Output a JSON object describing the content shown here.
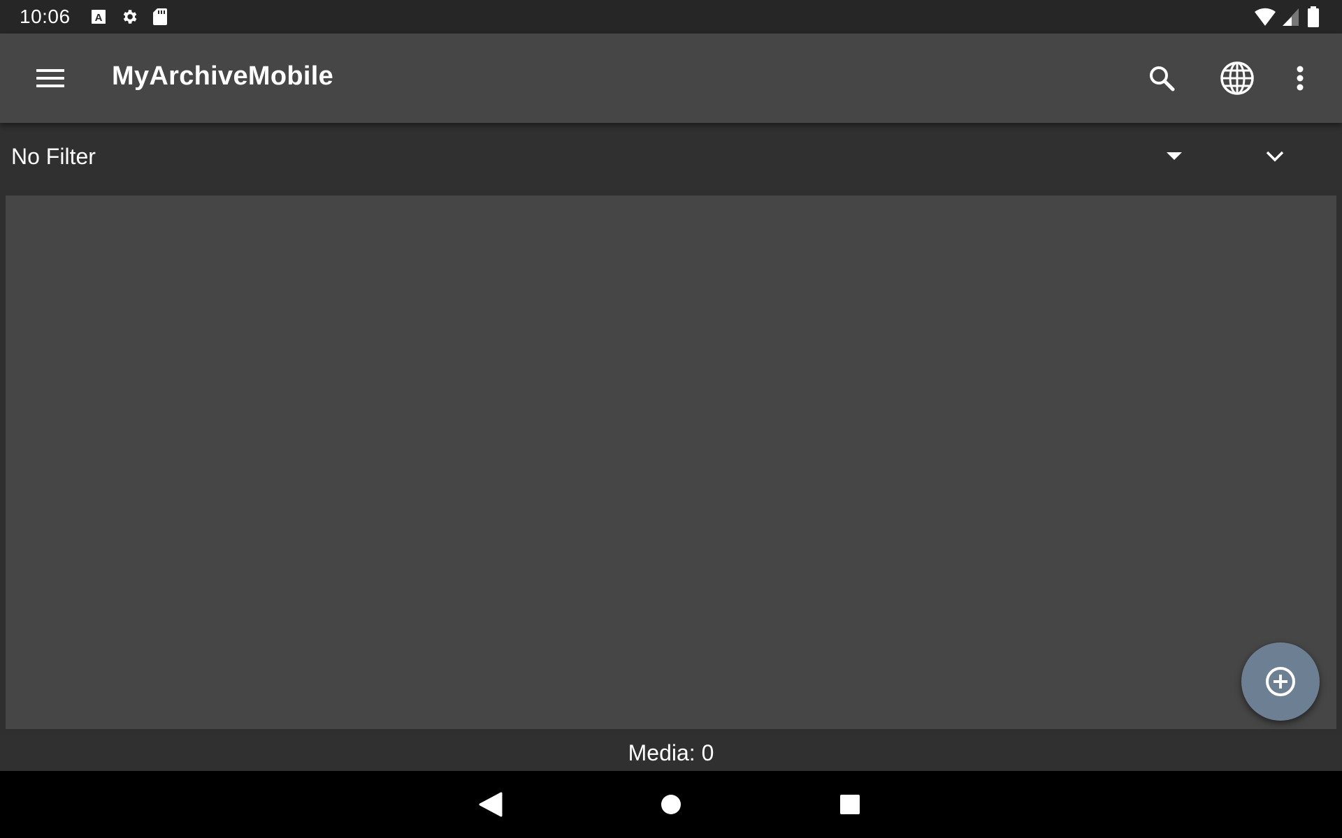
{
  "status_bar": {
    "time": "10:06",
    "icons": [
      "text-a-icon",
      "gear-icon",
      "sd-card-icon",
      "wifi-icon",
      "cell-signal-icon",
      "battery-icon"
    ]
  },
  "app_bar": {
    "title": "MyArchiveMobile",
    "actions": [
      "search-icon",
      "globe-icon",
      "more-vert-icon"
    ]
  },
  "filter": {
    "label": "No Filter"
  },
  "footer": {
    "media_count": "Media: 0"
  },
  "fab": {
    "icon": "add-circle-icon",
    "color": "#6d7f93"
  },
  "colors": {
    "app_bar": "#464646",
    "status_bar": "#262626",
    "filter_bar": "#303030",
    "content": "#464646"
  },
  "nav_bar": {
    "buttons": [
      "back-icon",
      "home-icon",
      "recents-icon"
    ]
  }
}
